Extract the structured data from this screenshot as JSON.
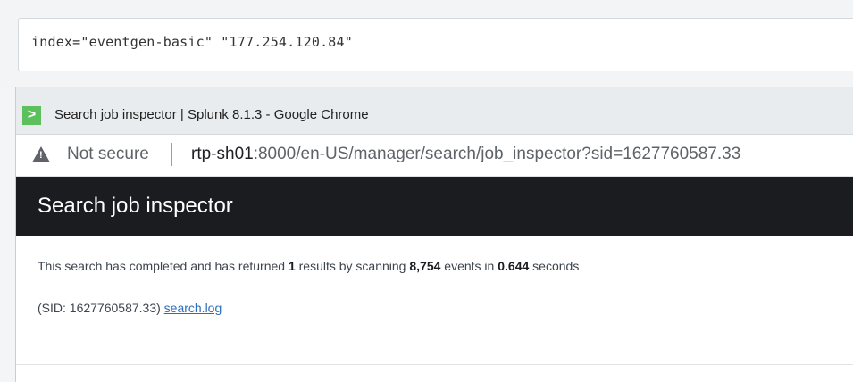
{
  "search": {
    "query": "index=\"eventgen-basic\" \"177.254.120.84\""
  },
  "window": {
    "app_icon": ">",
    "title": "Search job inspector | Splunk 8.1.3 - Google Chrome"
  },
  "address_bar": {
    "security_label": "Not secure",
    "url_host": "rtp-sh01",
    "url_rest": ":8000/en-US/manager/search/job_inspector?sid=1627760587.33"
  },
  "page": {
    "title": "Search job inspector",
    "summary": {
      "prefix": "This search has completed and has returned ",
      "results": "1",
      "mid1": " results by scanning ",
      "events": "8,754",
      "mid2": " events in ",
      "seconds": "0.644",
      "suffix": " seconds"
    },
    "sid_text": "(SID: 1627760587.33) ",
    "log_link": "search.log"
  },
  "colors": {
    "header_bg": "#1a1c20",
    "link": "#2a6ebb",
    "app_icon": "#5cc05c"
  }
}
